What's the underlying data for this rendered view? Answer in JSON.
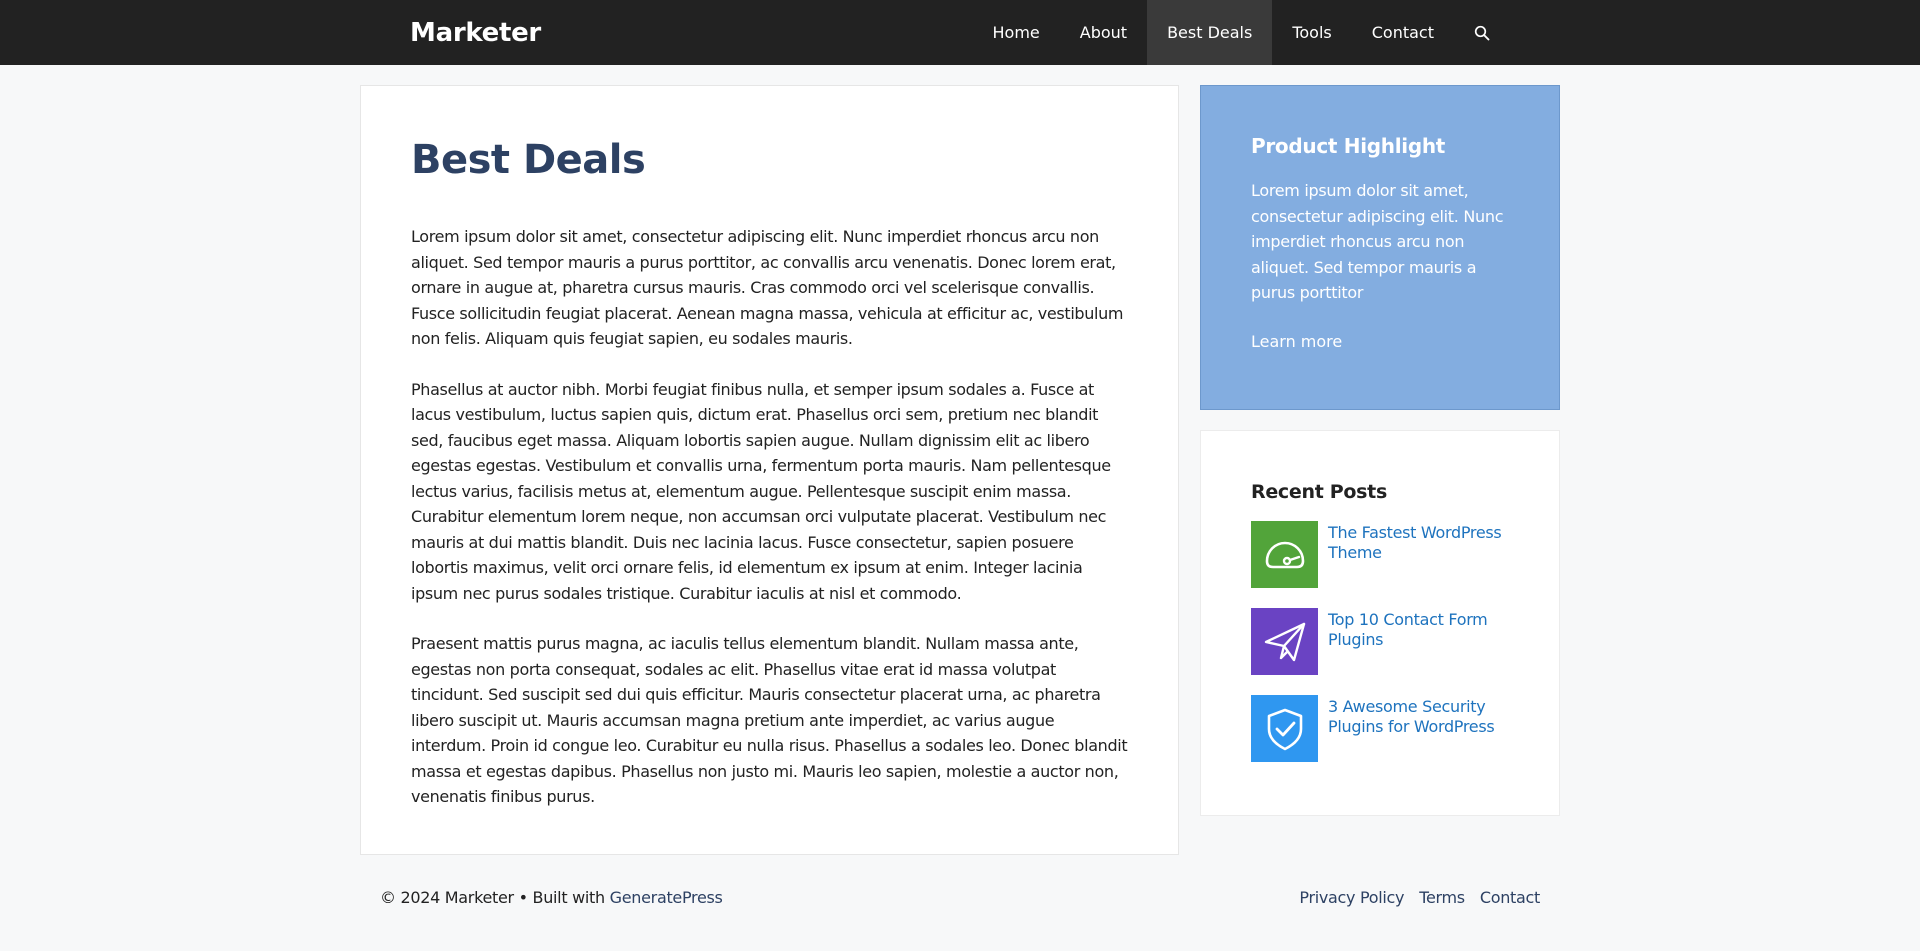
{
  "header": {
    "site_title": "Marketer",
    "nav": [
      "Home",
      "About",
      "Best Deals",
      "Tools",
      "Contact"
    ],
    "active_nav": "Best Deals",
    "search_icon": "search-icon"
  },
  "main": {
    "title": "Best Deals",
    "paragraphs": [
      "Lorem ipsum dolor sit amet, consectetur adipiscing elit. Nunc imperdiet rhoncus arcu non aliquet. Sed tempor mauris a purus porttitor, ac convallis arcu venenatis. Donec lorem erat, ornare in augue at, pharetra cursus mauris. Cras commodo orci vel scelerisque convallis. Fusce sollicitudin feugiat placerat. Aenean magna massa, vehicula at efficitur ac, vestibulum non felis. Aliquam quis feugiat sapien, eu sodales mauris.",
      "Phasellus at auctor nibh. Morbi feugiat finibus nulla, et semper ipsum sodales a. Fusce at lacus vestibulum, luctus sapien quis, dictum erat. Phasellus orci sem, pretium nec blandit sed, faucibus eget massa. Aliquam lobortis sapien augue. Nullam dignissim elit ac libero egestas egestas. Vestibulum et convallis urna, fermentum porta mauris. Nam pellentesque lectus varius, facilisis metus at, elementum augue. Pellentesque suscipit enim massa. Curabitur elementum lorem neque, non accumsan orci vulputate placerat. Vestibulum nec mauris at dui mattis blandit. Duis nec lacinia lacus. Fusce consectetur, sapien posuere lobortis maximus, velit orci ornare felis, id elementum ex ipsum at enim. Integer lacinia ipsum nec purus sodales tristique. Curabitur iaculis at nisl et commodo.",
      "Praesent mattis purus magna, ac iaculis tellus elementum blandit. Nullam massa ante, egestas non porta consequat, sodales ac elit. Phasellus vitae erat id massa volutpat tincidunt. Sed suscipit sed dui quis efficitur. Mauris consectetur placerat urna, ac pharetra libero suscipit ut. Mauris accumsan magna pretium ante imperdiet, ac varius augue interdum. Proin id congue leo. Curabitur eu nulla risus. Phasellus a sodales leo. Donec blandit massa et egestas dapibus. Phasellus non justo mi. Mauris leo sapien, molestie a auctor non, venenatis finibus purus."
    ]
  },
  "sidebar": {
    "highlight": {
      "title": "Product Highlight",
      "text": "Lorem ipsum dolor sit amet, consectetur adipiscing elit. Nunc imperdiet rhoncus arcu non aliquet. Sed tempor mauris a purus porttitor",
      "link": "Learn more",
      "bg_color": "#83ade0"
    },
    "recent_posts": {
      "title": "Recent Posts",
      "items": [
        {
          "label": "The Fastest WordPress Theme",
          "icon": "speedometer-icon",
          "color": "#52a43a"
        },
        {
          "label": "Top 10 Contact Form Plugins",
          "icon": "paper-plane-icon",
          "color": "#6a43c3"
        },
        {
          "label": "3 Awesome Security Plugins for WordPress",
          "icon": "shield-check-icon",
          "color": "#2f97f0"
        }
      ]
    }
  },
  "footer": {
    "copyright": "© 2024 Marketer • Built with",
    "builder": "GeneratePress",
    "links": [
      "Privacy Policy",
      "Terms",
      "Contact"
    ]
  },
  "colors": {
    "header_bg": "#222222",
    "title_color": "#2d4163",
    "link_color": "#1e73be"
  }
}
